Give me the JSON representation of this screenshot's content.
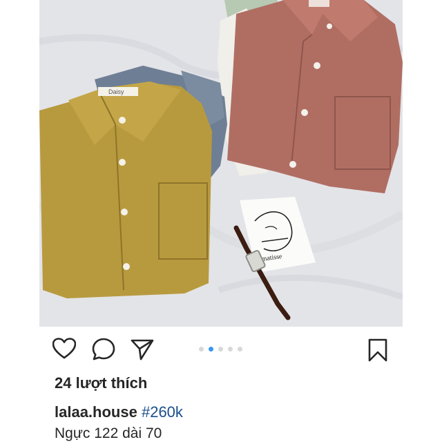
{
  "post": {
    "photo": {
      "shirt_colors": {
        "mustard": "#b89a3e",
        "rose": "#b06e63",
        "slate": "#6e7f95",
        "white": "#f1efe9",
        "mint": "#b7c8b3",
        "sheet": "#e3e4e8"
      },
      "brand_tag": "Daisy",
      "card_text": "matisse"
    },
    "actions": {
      "like_icon": "heart-outline",
      "comment_icon": "speech-bubble-outline",
      "share_icon": "paper-plane-outline",
      "save_icon": "bookmark-outline"
    },
    "carousel": {
      "count": 5,
      "active_index": 1,
      "active_color": "#3897f0",
      "inactive_color": "#d8d8d8"
    },
    "likes_text": "24 lượt thích",
    "caption": {
      "username": "lalaa.house",
      "hashtag": "#260k",
      "text": "Ngực 122 dài 70"
    }
  }
}
